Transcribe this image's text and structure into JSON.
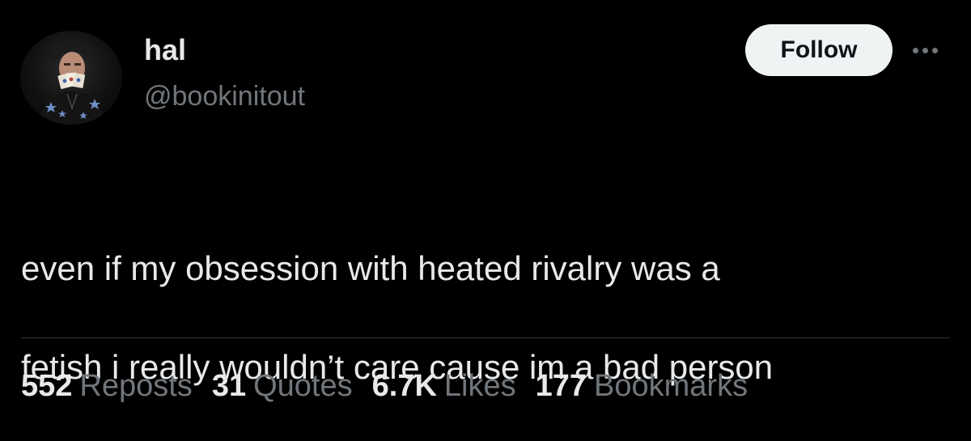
{
  "author": {
    "display_name": "hal",
    "handle": "@bookinitout",
    "avatar_icon": "profile-photo"
  },
  "follow_label": "Follow",
  "more_icon": "more-horizontal-icon",
  "tweet": {
    "line1": "even if my obsession with heated rivalry was a",
    "line2": "fetish i really wouldn’t care cause im a bad person"
  },
  "stats": [
    {
      "count": "552",
      "label": "Reposts"
    },
    {
      "count": "31",
      "label": "Quotes"
    },
    {
      "count": "6.7K",
      "label": "Likes"
    },
    {
      "count": "177",
      "label": "Bookmarks"
    }
  ],
  "colors": {
    "background": "#000000",
    "primary_text": "#e7e9ea",
    "secondary_text": "#71767b",
    "button_bg": "#eff3f4",
    "button_text": "#0f1419",
    "divider": "#2f3336"
  }
}
